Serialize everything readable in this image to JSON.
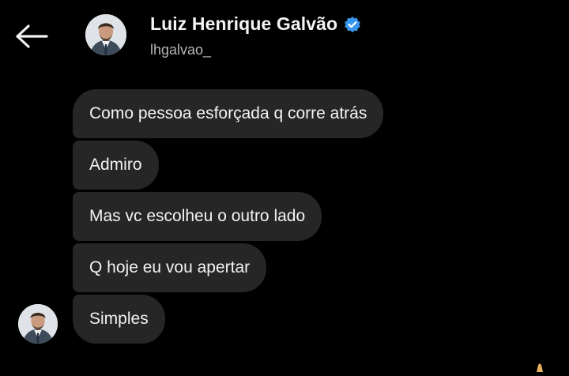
{
  "header": {
    "back_icon": "arrow-left-icon",
    "avatar_icon": "profile-photo",
    "name": "Luiz Henrique Galvão",
    "verified_icon": "verified-badge-icon",
    "username": "lhgalvao_"
  },
  "messages": [
    {
      "text": "Como pessoa esforçada q corre atrás"
    },
    {
      "text": "Admiro"
    },
    {
      "text": "Mas vc escolheu o outro lado"
    },
    {
      "text": "Q hoje eu vou apertar"
    },
    {
      "text": "Simples"
    }
  ],
  "colors": {
    "background": "#000000",
    "bubble": "#262626",
    "verified": "#3897f0",
    "username": "#b5b5b5"
  }
}
